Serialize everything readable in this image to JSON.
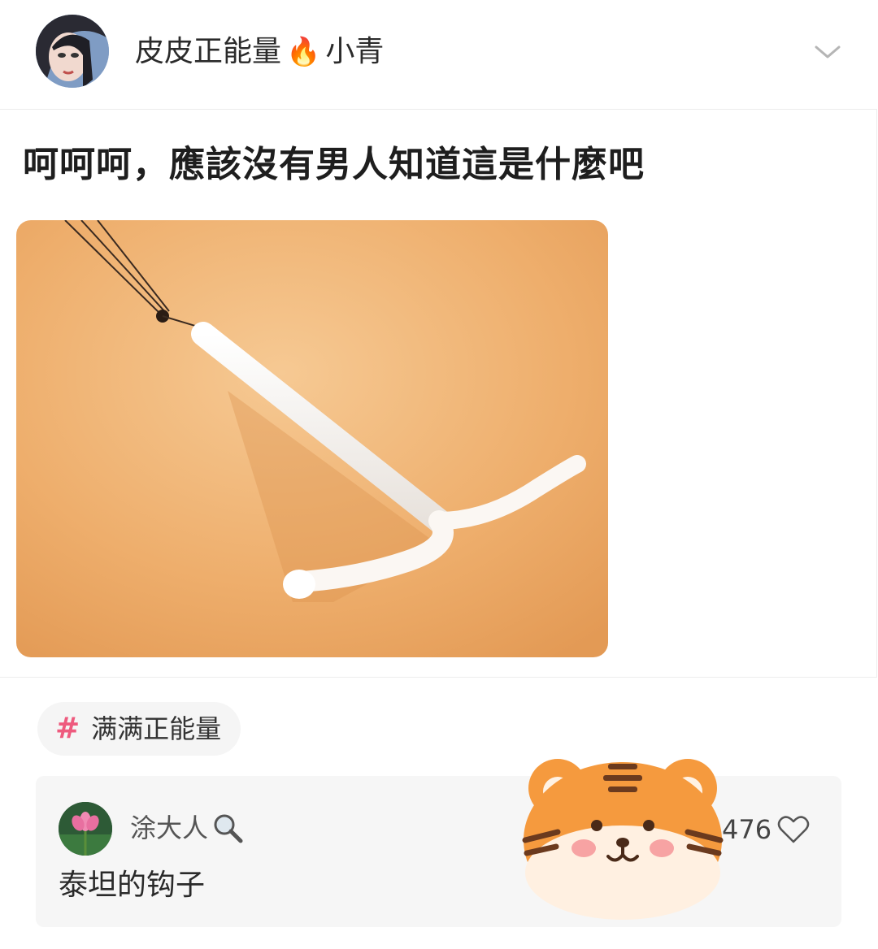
{
  "header": {
    "username_part1": "皮皮正能量",
    "username_emoji": "🔥",
    "username_part2": "小青",
    "avatar_icon": "user-avatar-icon",
    "more_icon": "chevron-down-icon"
  },
  "post": {
    "caption": "呵呵呵，應該沒有男人知道這是什麼吧"
  },
  "tag": {
    "hash": "#",
    "label": "满满正能量",
    "color": "#ee5a7e"
  },
  "comment": {
    "author": "涂大人",
    "author_icon": "magnifier-icon",
    "text": "泰坦的钩子",
    "likes": "476",
    "like_icon": "heart-icon"
  },
  "sticker": {
    "icon": "tiger-face-icon"
  }
}
